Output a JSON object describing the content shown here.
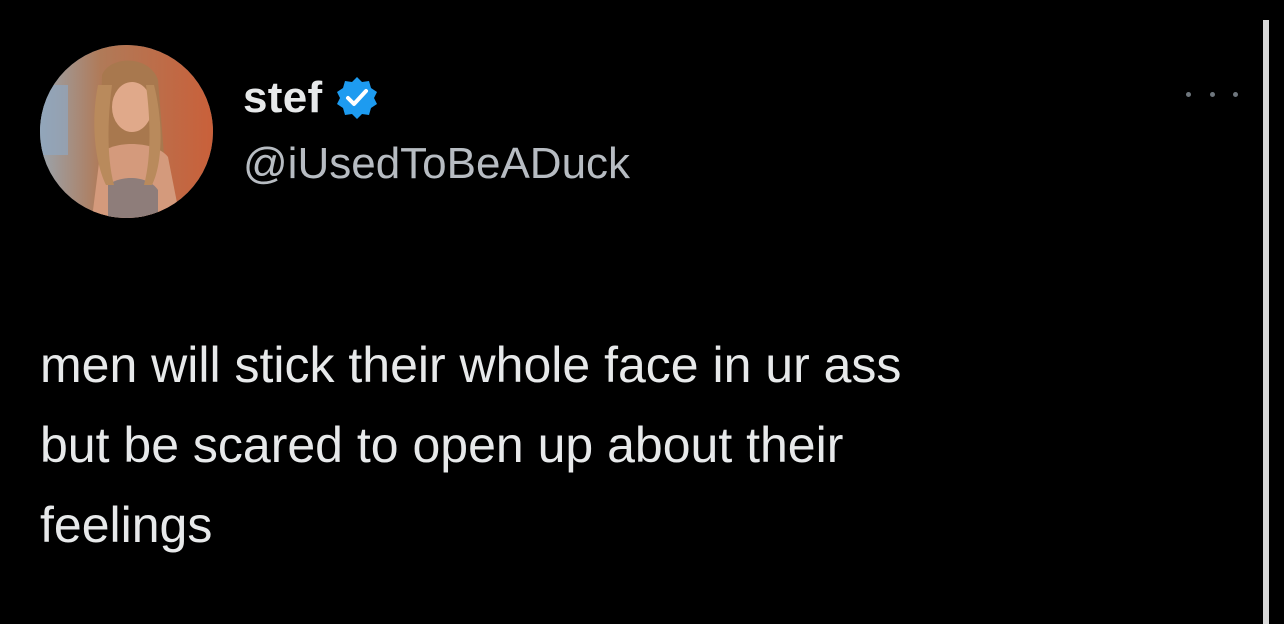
{
  "tweet": {
    "display_name": "stef",
    "handle": "@iUsedToBeADuck",
    "verified_icon": "verified-badge-icon",
    "more_icon": "more-options-icon",
    "text": "men will stick their whole face in ur ass\nbut be scared to open up about their\nfeelings"
  },
  "colors": {
    "background": "#000000",
    "text_primary": "#e7e9ea",
    "text_secondary": "#b7bcc2",
    "verified_blue": "#1d9bf0"
  }
}
